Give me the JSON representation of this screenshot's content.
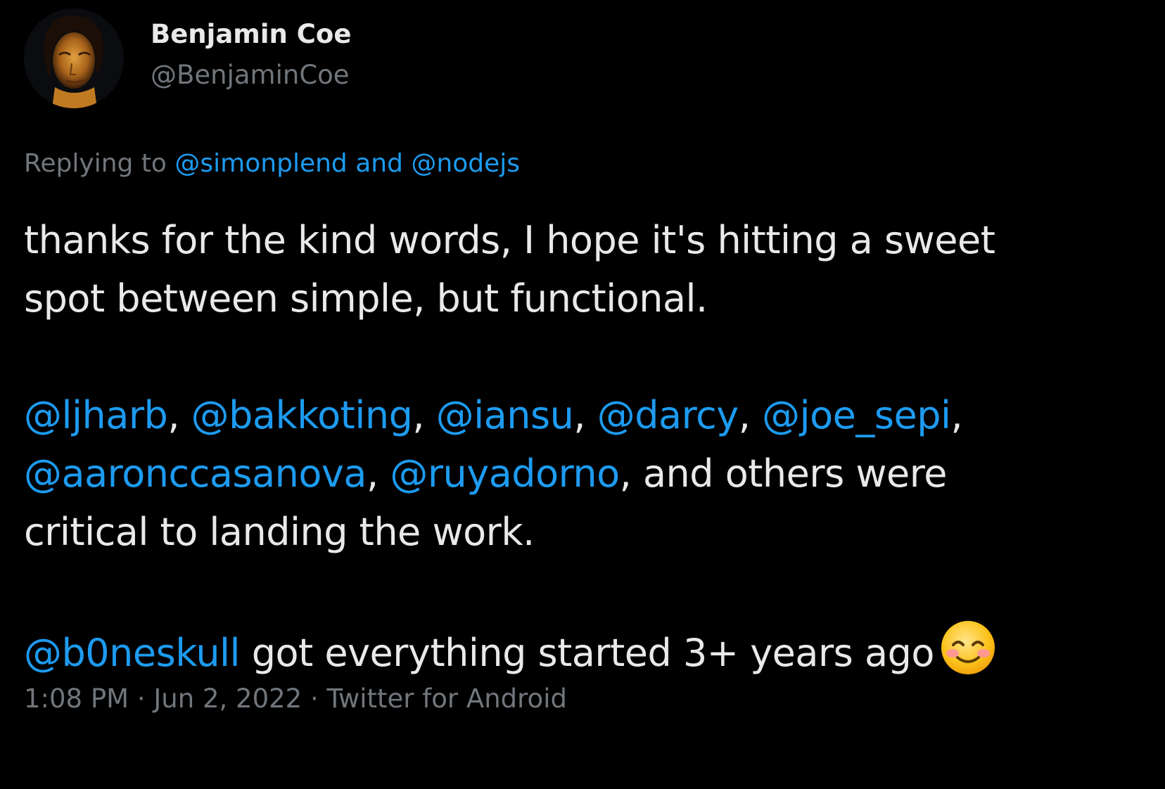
{
  "author": {
    "display_name": "Benjamin Coe",
    "handle": "@BenjaminCoe"
  },
  "reply_context": {
    "prefix": "Replying to",
    "users": [
      "@simonplend",
      "@nodejs"
    ],
    "joiner": "and"
  },
  "body": {
    "p1_line1": "thanks for the kind words, I hope it's hitting a sweet",
    "p1_line2": "spot between simple, but functional.",
    "p2_mentions_line1": [
      "@ljharb",
      "@bakkoting",
      "@iansu",
      "@darcy",
      "@joe_sepi"
    ],
    "p2_line2_mentions": [
      "@aaronccasanova",
      "@ruyadorno"
    ],
    "p2_line2_text": ", and others were",
    "p2_line3": "critical to landing the work.",
    "p3_mention": "@b0neskull",
    "p3_text": " got everything started 3+ years ago",
    "p3_emoji": "smiling-face-with-smiling-eyes-emoji",
    "comma": ","
  },
  "meta": {
    "time": "1:08 PM",
    "separator": "·",
    "date": "Jun 2, 2022",
    "source": "Twitter for Android"
  },
  "colors": {
    "background": "#000000",
    "text": "#e7e9ea",
    "secondary": "#71767b",
    "link": "#1d9bf0"
  }
}
